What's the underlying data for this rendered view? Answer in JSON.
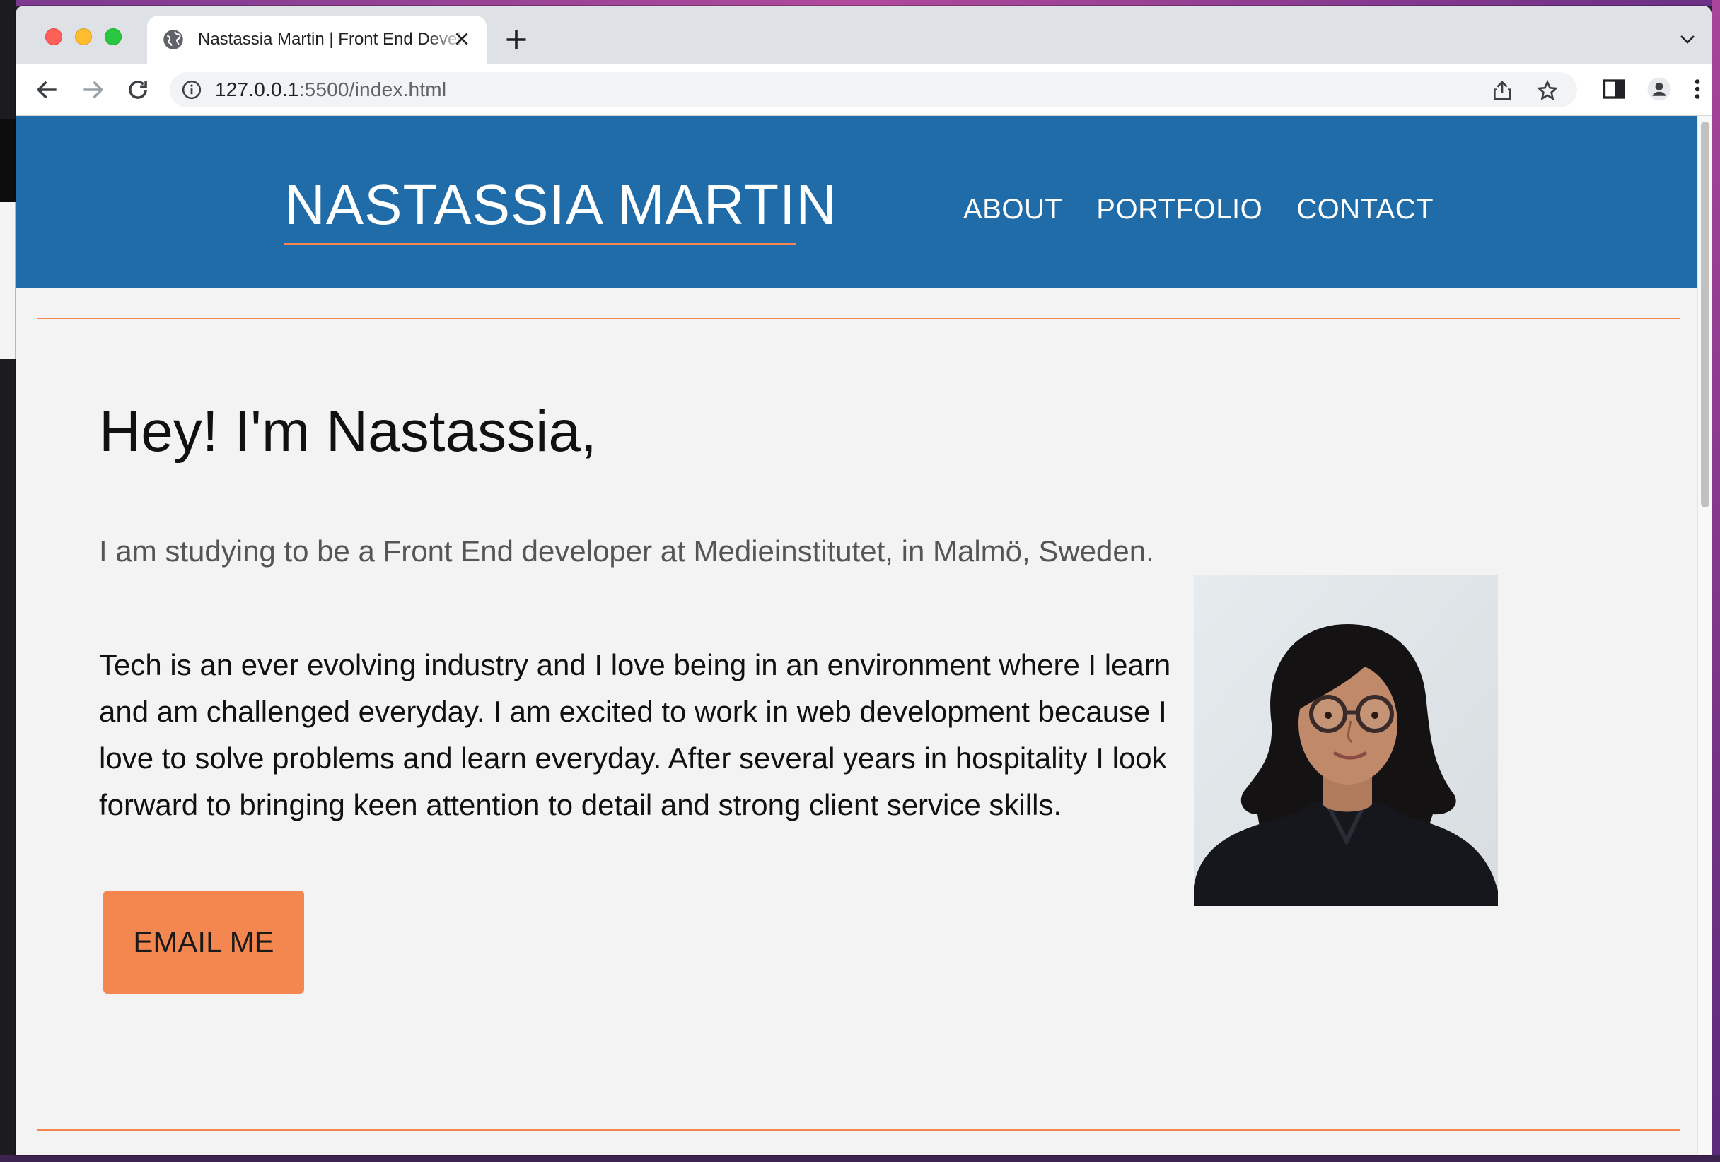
{
  "browser": {
    "tab_title": "Nastassia Martin | Front End Developer",
    "url_host": "127.0.0.1",
    "url_path": ":5500/index.html"
  },
  "site": {
    "brand": "NASTASSIA MARTIN",
    "nav": [
      "ABOUT",
      "PORTFOLIO",
      "CONTACT"
    ],
    "greeting": "Hey! I'm Nastassia,",
    "subtitle": "I am studying to be a Front End developer at Medieinstitutet, in Malmö, Sweden.",
    "bio": "Tech is an ever evolving industry and I love being in an environment where I learn and am challenged everyday. I am excited to work in web development because I love to solve problems and learn everyday. After several years in hospitality I look forward to bringing keen attention to detail and strong client service skills.",
    "email_button": "EMAIL ME"
  },
  "colors": {
    "header_blue": "#206ca8",
    "accent_orange": "#f4874f",
    "page_bg": "#f3f3f3"
  }
}
